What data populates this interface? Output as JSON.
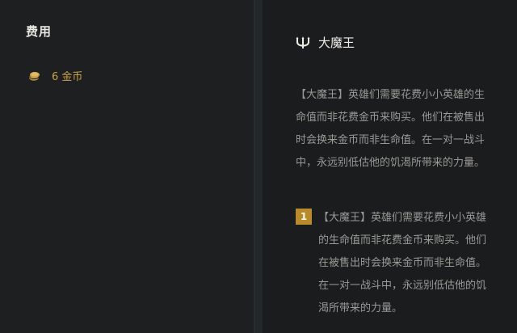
{
  "cost": {
    "heading": "费用",
    "icon": "coin-icon",
    "value": "6 金币",
    "accent_color": "#c9a24a"
  },
  "augment": {
    "icon": "trident-icon",
    "title": "大魔王",
    "description": "【大魔王】英雄们需要花费小小英雄的生命值而非花费金币来购买。他们在被售出时会换来金币而非生命值。在一对一战斗中，永远别低估他的饥渴所带来的力量。",
    "tiers": [
      {
        "level": "1",
        "text": "【大魔王】英雄们需要花费小小英雄的生命值而非花费金币来购买。他们在被售出时会换来金币而非生命值。在一对一战斗中，永远别低估他的饥渴所带来的力量。",
        "badge_color": "#b78b2c"
      }
    ]
  }
}
